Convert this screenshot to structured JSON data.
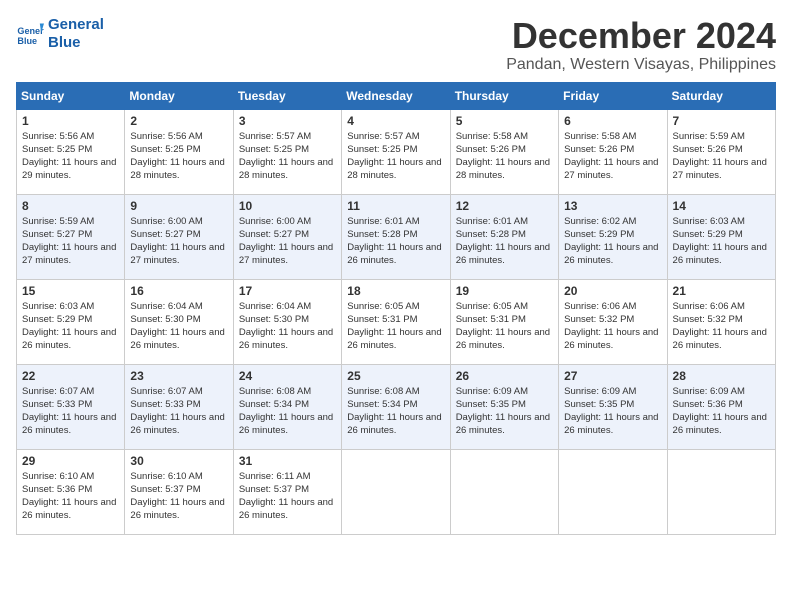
{
  "header": {
    "logo_line1": "General",
    "logo_line2": "Blue",
    "month": "December 2024",
    "location": "Pandan, Western Visayas, Philippines"
  },
  "days_of_week": [
    "Sunday",
    "Monday",
    "Tuesday",
    "Wednesday",
    "Thursday",
    "Friday",
    "Saturday"
  ],
  "weeks": [
    [
      {
        "day": "1",
        "sunrise": "5:56 AM",
        "sunset": "5:25 PM",
        "daylight": "11 hours and 29 minutes."
      },
      {
        "day": "2",
        "sunrise": "5:56 AM",
        "sunset": "5:25 PM",
        "daylight": "11 hours and 28 minutes."
      },
      {
        "day": "3",
        "sunrise": "5:57 AM",
        "sunset": "5:25 PM",
        "daylight": "11 hours and 28 minutes."
      },
      {
        "day": "4",
        "sunrise": "5:57 AM",
        "sunset": "5:25 PM",
        "daylight": "11 hours and 28 minutes."
      },
      {
        "day": "5",
        "sunrise": "5:58 AM",
        "sunset": "5:26 PM",
        "daylight": "11 hours and 28 minutes."
      },
      {
        "day": "6",
        "sunrise": "5:58 AM",
        "sunset": "5:26 PM",
        "daylight": "11 hours and 27 minutes."
      },
      {
        "day": "7",
        "sunrise": "5:59 AM",
        "sunset": "5:26 PM",
        "daylight": "11 hours and 27 minutes."
      }
    ],
    [
      {
        "day": "8",
        "sunrise": "5:59 AM",
        "sunset": "5:27 PM",
        "daylight": "11 hours and 27 minutes."
      },
      {
        "day": "9",
        "sunrise": "6:00 AM",
        "sunset": "5:27 PM",
        "daylight": "11 hours and 27 minutes."
      },
      {
        "day": "10",
        "sunrise": "6:00 AM",
        "sunset": "5:27 PM",
        "daylight": "11 hours and 27 minutes."
      },
      {
        "day": "11",
        "sunrise": "6:01 AM",
        "sunset": "5:28 PM",
        "daylight": "11 hours and 26 minutes."
      },
      {
        "day": "12",
        "sunrise": "6:01 AM",
        "sunset": "5:28 PM",
        "daylight": "11 hours and 26 minutes."
      },
      {
        "day": "13",
        "sunrise": "6:02 AM",
        "sunset": "5:29 PM",
        "daylight": "11 hours and 26 minutes."
      },
      {
        "day": "14",
        "sunrise": "6:03 AM",
        "sunset": "5:29 PM",
        "daylight": "11 hours and 26 minutes."
      }
    ],
    [
      {
        "day": "15",
        "sunrise": "6:03 AM",
        "sunset": "5:29 PM",
        "daylight": "11 hours and 26 minutes."
      },
      {
        "day": "16",
        "sunrise": "6:04 AM",
        "sunset": "5:30 PM",
        "daylight": "11 hours and 26 minutes."
      },
      {
        "day": "17",
        "sunrise": "6:04 AM",
        "sunset": "5:30 PM",
        "daylight": "11 hours and 26 minutes."
      },
      {
        "day": "18",
        "sunrise": "6:05 AM",
        "sunset": "5:31 PM",
        "daylight": "11 hours and 26 minutes."
      },
      {
        "day": "19",
        "sunrise": "6:05 AM",
        "sunset": "5:31 PM",
        "daylight": "11 hours and 26 minutes."
      },
      {
        "day": "20",
        "sunrise": "6:06 AM",
        "sunset": "5:32 PM",
        "daylight": "11 hours and 26 minutes."
      },
      {
        "day": "21",
        "sunrise": "6:06 AM",
        "sunset": "5:32 PM",
        "daylight": "11 hours and 26 minutes."
      }
    ],
    [
      {
        "day": "22",
        "sunrise": "6:07 AM",
        "sunset": "5:33 PM",
        "daylight": "11 hours and 26 minutes."
      },
      {
        "day": "23",
        "sunrise": "6:07 AM",
        "sunset": "5:33 PM",
        "daylight": "11 hours and 26 minutes."
      },
      {
        "day": "24",
        "sunrise": "6:08 AM",
        "sunset": "5:34 PM",
        "daylight": "11 hours and 26 minutes."
      },
      {
        "day": "25",
        "sunrise": "6:08 AM",
        "sunset": "5:34 PM",
        "daylight": "11 hours and 26 minutes."
      },
      {
        "day": "26",
        "sunrise": "6:09 AM",
        "sunset": "5:35 PM",
        "daylight": "11 hours and 26 minutes."
      },
      {
        "day": "27",
        "sunrise": "6:09 AM",
        "sunset": "5:35 PM",
        "daylight": "11 hours and 26 minutes."
      },
      {
        "day": "28",
        "sunrise": "6:09 AM",
        "sunset": "5:36 PM",
        "daylight": "11 hours and 26 minutes."
      }
    ],
    [
      {
        "day": "29",
        "sunrise": "6:10 AM",
        "sunset": "5:36 PM",
        "daylight": "11 hours and 26 minutes."
      },
      {
        "day": "30",
        "sunrise": "6:10 AM",
        "sunset": "5:37 PM",
        "daylight": "11 hours and 26 minutes."
      },
      {
        "day": "31",
        "sunrise": "6:11 AM",
        "sunset": "5:37 PM",
        "daylight": "11 hours and 26 minutes."
      },
      null,
      null,
      null,
      null
    ]
  ]
}
